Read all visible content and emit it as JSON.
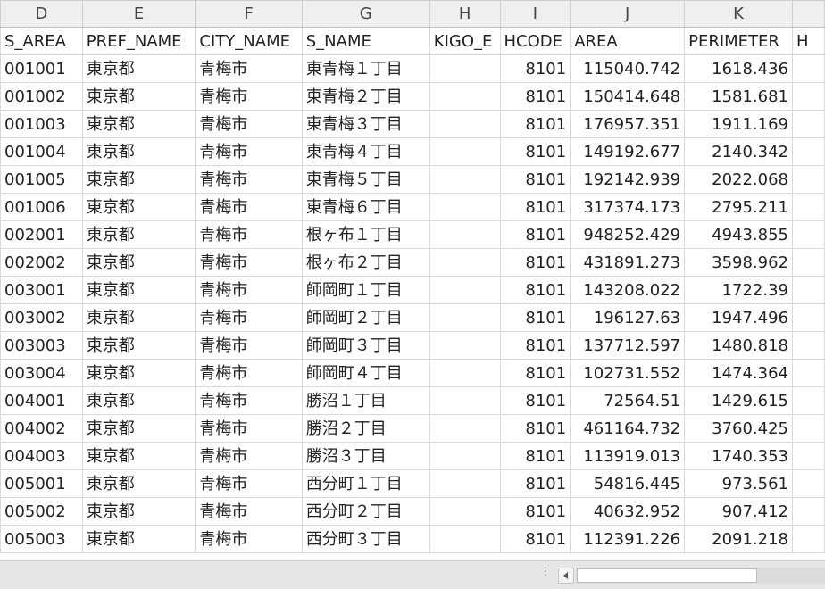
{
  "columns": [
    {
      "letter": "D",
      "header": "S_AREA",
      "align": "txt"
    },
    {
      "letter": "E",
      "header": "PREF_NAME",
      "align": "txt"
    },
    {
      "letter": "F",
      "header": "CITY_NAME",
      "align": "txt"
    },
    {
      "letter": "G",
      "header": "S_NAME",
      "align": "txt"
    },
    {
      "letter": "H",
      "header": "KIGO_E",
      "align": "txt"
    },
    {
      "letter": "I",
      "header": "HCODE",
      "align": "txt"
    },
    {
      "letter": "J",
      "header": "AREA",
      "align": "txt"
    },
    {
      "letter": "K",
      "header": "PERIMETER",
      "align": "txt"
    },
    {
      "letter": "",
      "header": "H",
      "align": "txt"
    }
  ],
  "rows": [
    [
      "001001",
      "東京都",
      "青梅市",
      "東青梅１丁目",
      "",
      "8101",
      "115040.742",
      "1618.436"
    ],
    [
      "001002",
      "東京都",
      "青梅市",
      "東青梅２丁目",
      "",
      "8101",
      "150414.648",
      "1581.681"
    ],
    [
      "001003",
      "東京都",
      "青梅市",
      "東青梅３丁目",
      "",
      "8101",
      "176957.351",
      "1911.169"
    ],
    [
      "001004",
      "東京都",
      "青梅市",
      "東青梅４丁目",
      "",
      "8101",
      "149192.677",
      "2140.342"
    ],
    [
      "001005",
      "東京都",
      "青梅市",
      "東青梅５丁目",
      "",
      "8101",
      "192142.939",
      "2022.068"
    ],
    [
      "001006",
      "東京都",
      "青梅市",
      "東青梅６丁目",
      "",
      "8101",
      "317374.173",
      "2795.211"
    ],
    [
      "002001",
      "東京都",
      "青梅市",
      "根ヶ布１丁目",
      "",
      "8101",
      "948252.429",
      "4943.855"
    ],
    [
      "002002",
      "東京都",
      "青梅市",
      "根ヶ布２丁目",
      "",
      "8101",
      "431891.273",
      "3598.962"
    ],
    [
      "003001",
      "東京都",
      "青梅市",
      "師岡町１丁目",
      "",
      "8101",
      "143208.022",
      "1722.39"
    ],
    [
      "003002",
      "東京都",
      "青梅市",
      "師岡町２丁目",
      "",
      "8101",
      "196127.63",
      "1947.496"
    ],
    [
      "003003",
      "東京都",
      "青梅市",
      "師岡町３丁目",
      "",
      "8101",
      "137712.597",
      "1480.818"
    ],
    [
      "003004",
      "東京都",
      "青梅市",
      "師岡町４丁目",
      "",
      "8101",
      "102731.552",
      "1474.364"
    ],
    [
      "004001",
      "東京都",
      "青梅市",
      "勝沼１丁目",
      "",
      "8101",
      "72564.51",
      "1429.615"
    ],
    [
      "004002",
      "東京都",
      "青梅市",
      "勝沼２丁目",
      "",
      "8101",
      "461164.732",
      "3760.425"
    ],
    [
      "004003",
      "東京都",
      "青梅市",
      "勝沼３丁目",
      "",
      "8101",
      "113919.013",
      "1740.353"
    ],
    [
      "005001",
      "東京都",
      "青梅市",
      "西分町１丁目",
      "",
      "8101",
      "54816.445",
      "973.561"
    ],
    [
      "005002",
      "東京都",
      "青梅市",
      "西分町２丁目",
      "",
      "8101",
      "40632.952",
      "907.412"
    ],
    [
      "005003",
      "東京都",
      "青梅市",
      "西分町３丁目",
      "",
      "8101",
      "112391.226",
      "2091.218"
    ]
  ],
  "numeric_columns": [
    5,
    6,
    7
  ],
  "colors": {
    "header_bg": "#efefef",
    "grid_line": "#d9d9d9",
    "bottom_bar": "#e6e6e6"
  }
}
